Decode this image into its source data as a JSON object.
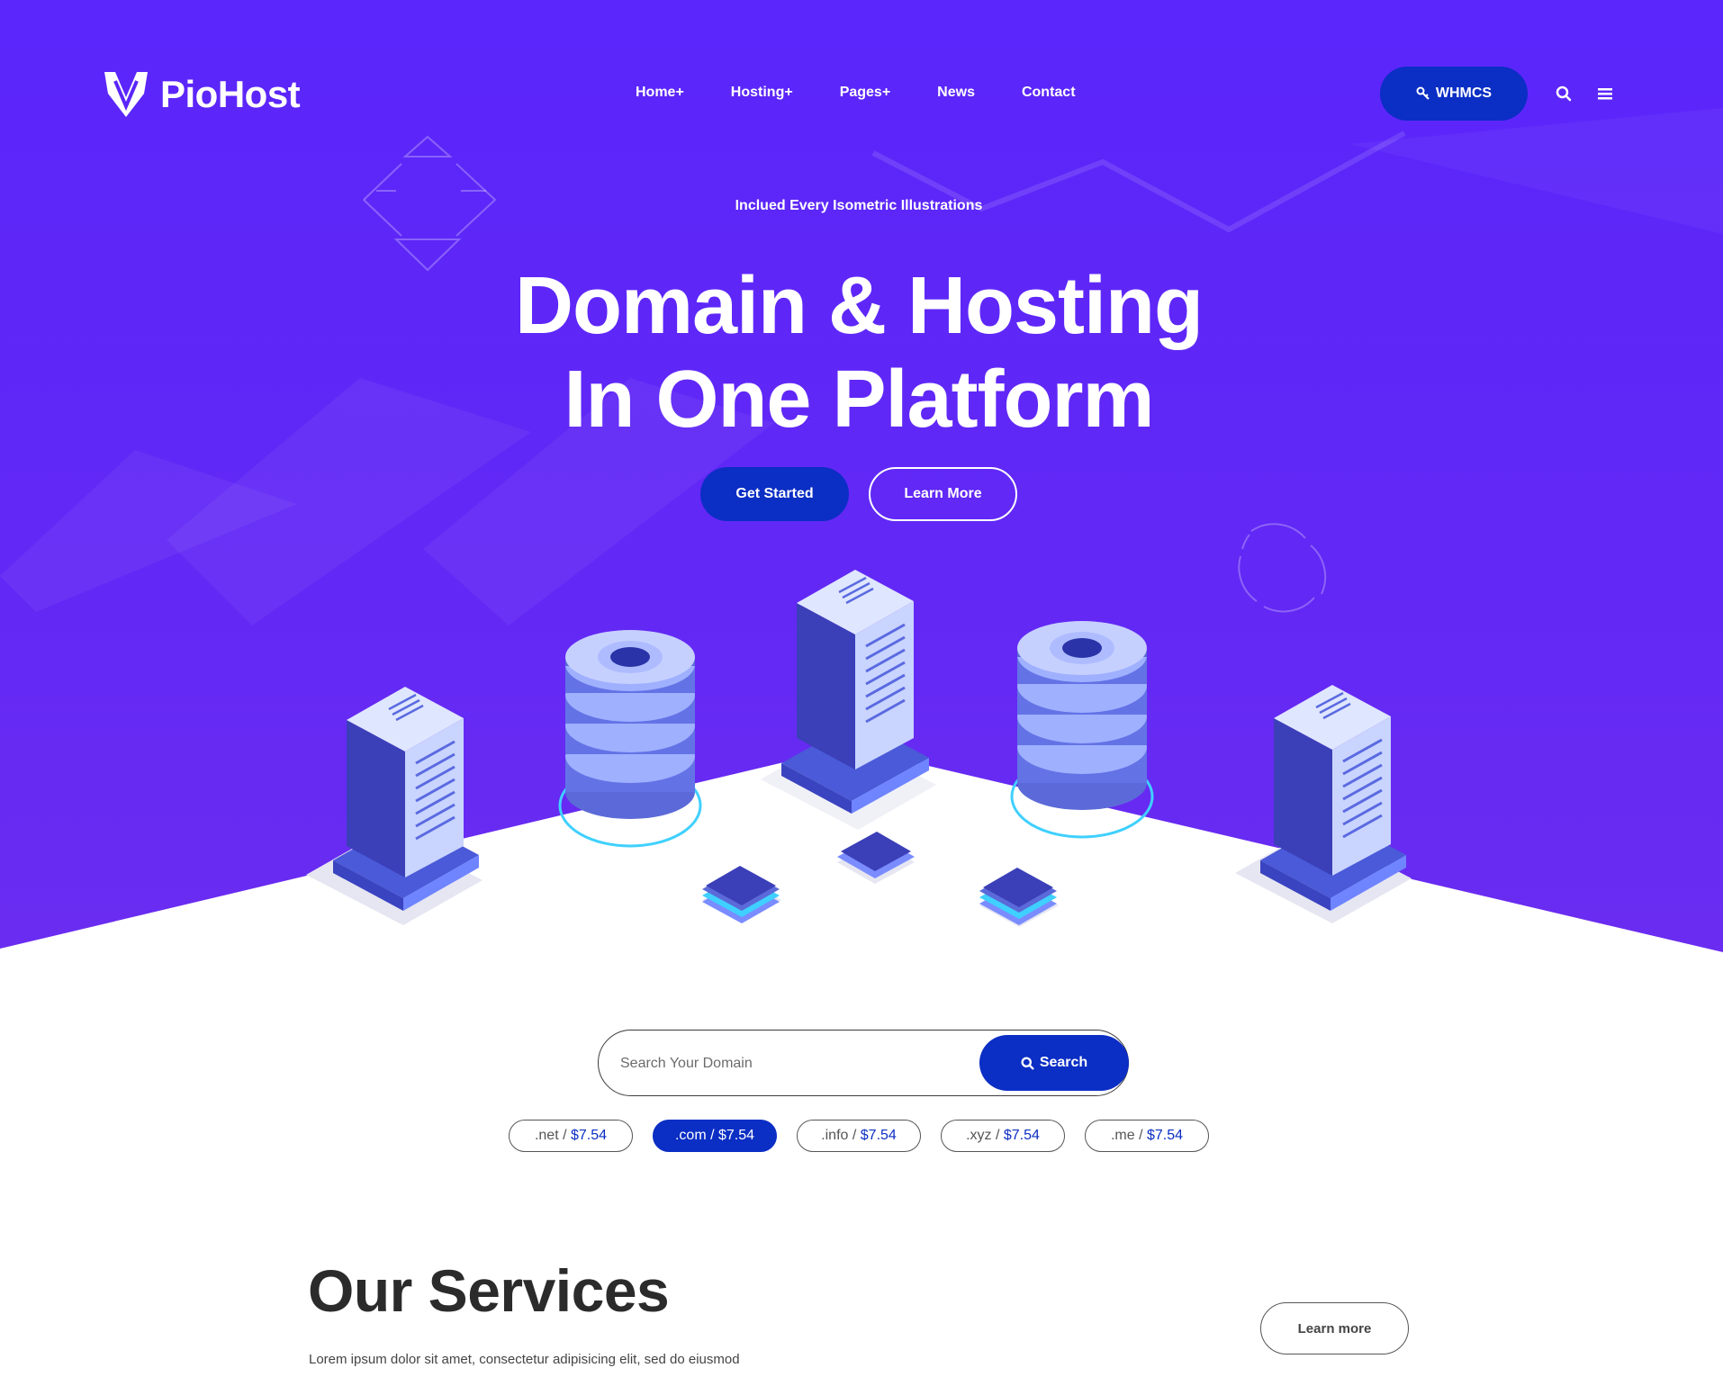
{
  "brand": {
    "name": "PioHost"
  },
  "nav": {
    "items": [
      "Home+",
      "Hosting+",
      "Pages+",
      "News",
      "Contact"
    ]
  },
  "header": {
    "whmcs_label": "WHMCS"
  },
  "hero": {
    "eyebrow": "Inclued Every Isometric Illustrations",
    "title_line1": "Domain & Hosting",
    "title_line2": "In One Platform",
    "primary_label": "Get Started",
    "secondary_label": "Learn More"
  },
  "domain_search": {
    "placeholder": "Search Your Domain",
    "button_label": "Search",
    "tlds": [
      {
        "ext": ".net /",
        "price": "$7.54",
        "active": false
      },
      {
        "ext": ".com /",
        "price": "$7.54",
        "active": true
      },
      {
        "ext": ".info /",
        "price": "$7.54",
        "active": false
      },
      {
        "ext": ".xyz /",
        "price": "$7.54",
        "active": false
      },
      {
        "ext": ".me /",
        "price": "$7.54",
        "active": false
      }
    ]
  },
  "services": {
    "title": "Our Services",
    "description": "Lorem ipsum dolor sit amet, consectetur adipisicing elit, sed do eiusmod",
    "learn_more_label": "Learn more"
  },
  "colors": {
    "hero_bg": "#5a26fb",
    "accent": "#0b2ec4",
    "text_dark": "#2b2b2b"
  },
  "icons": [
    "logo-icon",
    "key-icon",
    "search-icon",
    "menu-icon"
  ]
}
